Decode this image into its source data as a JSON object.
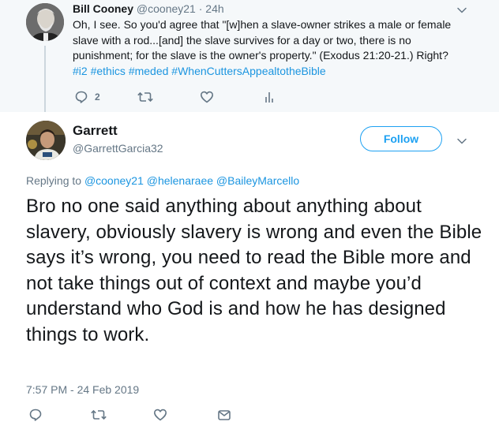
{
  "parent_tweet": {
    "name": "Bill Cooney",
    "handle": "@cooney21",
    "separator": " · ",
    "time": "24h",
    "text_lines": [
      "Oh, I see. So you'd agree that \"[w]hen a slave-owner strikes a male or female",
      "slave with a rod...[and] the slave survives for a day or two, there is no",
      "punishment; for the slave is the owner's property.\" (Exodus 21:20-21.) Right?"
    ],
    "hashtags": "#i2 #ethics #meded #WhenCuttersAppealtotheBible",
    "reply_count": "2",
    "icons": [
      "reply-icon",
      "retweet-icon",
      "like-icon",
      "analytics-icon",
      "chevron-down-icon"
    ]
  },
  "main_tweet": {
    "name": "Garrett",
    "handle": "@GarrettGarcia32",
    "follow_label": "Follow",
    "replying_prefix": "Replying to ",
    "mentions": "@cooney21 @helenaraee @BaileyMarcello",
    "text": "Bro no one said anything about anything about slavery, obviously slavery is wrong and even the Bible says it’s wrong, you need to read the Bible more and not take things out of context and maybe you’d understand who God is and how he has designed things to work.",
    "timestamp": "7:57 PM - 24 Feb 2019",
    "icons": [
      "reply-icon",
      "retweet-icon",
      "like-icon",
      "message-icon",
      "chevron-down-icon"
    ]
  },
  "colors": {
    "accent": "#1da1f2",
    "link": "#1b95e0",
    "secondary_text": "#657786",
    "parent_bg": "#f5f8fa"
  }
}
